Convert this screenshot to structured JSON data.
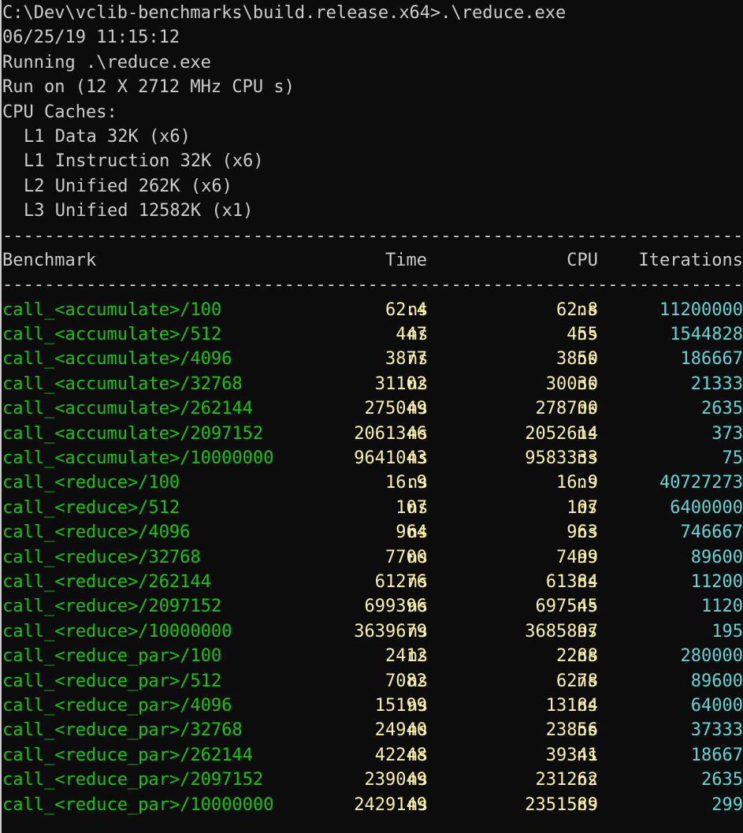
{
  "window": {
    "prompt": "C:\\Dev\\vclib-benchmarks\\build.release.x64>.\\reduce.exe"
  },
  "header_info": {
    "timestamp": "06/25/19 11:15:12",
    "running": "Running .\\reduce.exe",
    "run_on": "Run on (12 X 2712 MHz CPU s)",
    "caches_title": "CPU Caches:",
    "caches": [
      "L1 Data 32K (x6)",
      "L1 Instruction 32K (x6)",
      "L2 Unified 262K (x6)",
      "L3 Unified 12582K (x1)"
    ]
  },
  "separator": "--------------------------------------------------------------------------------------------------------------",
  "table": {
    "columns": {
      "benchmark": "Benchmark",
      "time": "Time",
      "cpu": "CPU",
      "iterations": "Iterations"
    },
    "unit": "ns",
    "rows": [
      {
        "name": "call_<accumulate>/100",
        "time": "62.4",
        "cpu": "62.8",
        "iterations": "11200000"
      },
      {
        "name": "call_<accumulate>/512",
        "time": "447",
        "cpu": "455",
        "iterations": "1544828"
      },
      {
        "name": "call_<accumulate>/4096",
        "time": "3877",
        "cpu": "3850",
        "iterations": "186667"
      },
      {
        "name": "call_<accumulate>/32768",
        "time": "31102",
        "cpu": "30030",
        "iterations": "21333"
      },
      {
        "name": "call_<accumulate>/262144",
        "time": "275049",
        "cpu": "278700",
        "iterations": "2635"
      },
      {
        "name": "call_<accumulate>/2097152",
        "time": "2061346",
        "cpu": "2052614",
        "iterations": "373"
      },
      {
        "name": "call_<accumulate>/10000000",
        "time": "9641043",
        "cpu": "9583333",
        "iterations": "75"
      },
      {
        "name": "call_<reduce>/100",
        "time": "16.9",
        "cpu": "16.9",
        "iterations": "40727273"
      },
      {
        "name": "call_<reduce>/512",
        "time": "107",
        "cpu": "107",
        "iterations": "6400000"
      },
      {
        "name": "call_<reduce>/4096",
        "time": "964",
        "cpu": "963",
        "iterations": "746667"
      },
      {
        "name": "call_<reduce>/32768",
        "time": "7700",
        "cpu": "7499",
        "iterations": "89600"
      },
      {
        "name": "call_<reduce>/262144",
        "time": "61276",
        "cpu": "61384",
        "iterations": "11200"
      },
      {
        "name": "call_<reduce>/2097152",
        "time": "699396",
        "cpu": "697545",
        "iterations": "1120"
      },
      {
        "name": "call_<reduce>/10000000",
        "time": "3639679",
        "cpu": "3685897",
        "iterations": "195"
      },
      {
        "name": "call_<reduce_par>/100",
        "time": "2412",
        "cpu": "2288",
        "iterations": "280000"
      },
      {
        "name": "call_<reduce_par>/512",
        "time": "7082",
        "cpu": "6278",
        "iterations": "89600"
      },
      {
        "name": "call_<reduce_par>/4096",
        "time": "15199",
        "cpu": "13184",
        "iterations": "64000"
      },
      {
        "name": "call_<reduce_par>/32768",
        "time": "24940",
        "cpu": "23856",
        "iterations": "37333"
      },
      {
        "name": "call_<reduce_par>/262144",
        "time": "42248",
        "cpu": "39341",
        "iterations": "18667"
      },
      {
        "name": "call_<reduce_par>/2097152",
        "time": "239049",
        "cpu": "231262",
        "iterations": "2635"
      },
      {
        "name": "call_<reduce_par>/10000000",
        "time": "2429149",
        "cpu": "2351589",
        "iterations": "299"
      }
    ]
  },
  "colors": {
    "background": "#0c0c0c",
    "text": "#cccccc",
    "name": "#16c60c",
    "value": "#f9f1a5",
    "iterations": "#61d6d6"
  }
}
